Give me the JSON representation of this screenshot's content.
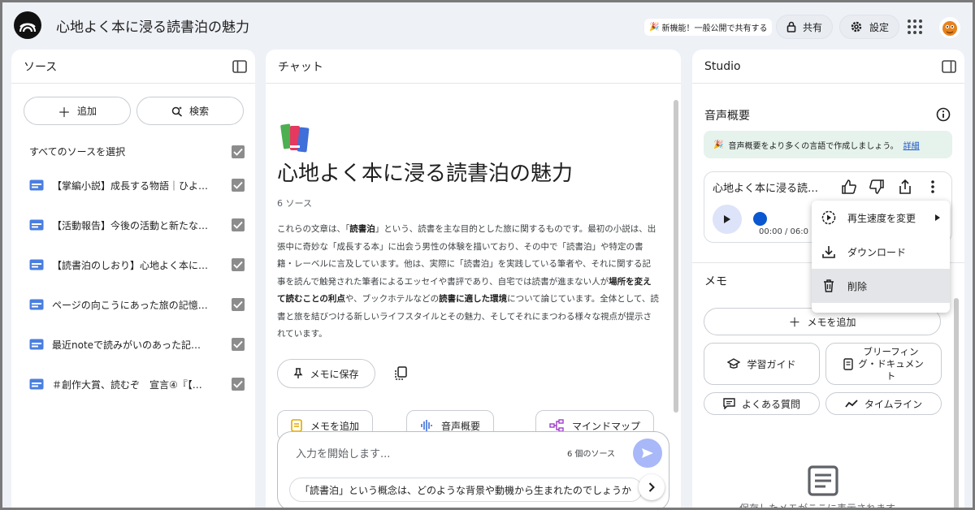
{
  "app": {
    "title": "心地よく本に浸る読書泊の魅力",
    "new_feature": "新機能！一般公開で共有する",
    "share": "共有",
    "settings": "設定"
  },
  "sources": {
    "heading": "ソース",
    "add": "追加",
    "search": "検索",
    "select_all": "すべてのソースを選択",
    "items": [
      {
        "label": "【掌編小説】成長する物語｜ひよ…"
      },
      {
        "label": "【活動報告】今後の活動と新たな…"
      },
      {
        "label": "【読書泊のしおり】心地よく本に…"
      },
      {
        "label": "ページの向こうにあった旅の記憶…"
      },
      {
        "label": "最近noteで読みがいのあった記事2…"
      },
      {
        "label": "＃創作大賞、読むぞ　宣言④『【読…"
      }
    ]
  },
  "chat": {
    "heading": "チャット",
    "notebook_title": "心地よく本に浸る読書泊の魅力",
    "source_count": "6 ソース",
    "summary": {
      "t1": "これらの文章は、「",
      "b1": "読書泊",
      "t2": "」という、読書を主な目的とした旅に関するものです。最初の小説は、出張中に奇妙な「成長する本」に出会う男性の体験を描いており、その中で「読書泊」や特定の書籍・レーベルに言及しています。他は、実際に「読書泊」を実践している筆者や、それに関する記事を読んで触発された筆者によるエッセイや書評であり、自宅では読書が進まない人が",
      "b2": "場所を変えて読むことの利点",
      "t3": "や、ブックホテルなどの",
      "b3": "読書に適した環境",
      "t4": "について論じています。全体として、読書と旅を結びつける新しいライフスタイルとその魅力、そしてそれにまつわる様々な視点が提示されています。"
    },
    "save_memo": "メモに保存",
    "chips": {
      "add_memo": "メモを追加",
      "audio": "音声概要",
      "mindmap": "マインドマップ"
    },
    "input_placeholder": "入力を開始します...",
    "input_sources": "6 個のソース",
    "suggestion": "「読書泊」という概念は、どのような背景や動機から生まれたのでしょうか"
  },
  "studio": {
    "heading": "Studio",
    "audio_overview": "音声概要",
    "banner_text": "音声概要をより多くの言語で作成しましょう。",
    "banner_link": "詳細",
    "audio_title": "心地よく本に浸る読…",
    "time": "00:00 / 06:0",
    "menu": {
      "speed": "再生速度を変更",
      "download": "ダウンロード",
      "delete": "削除"
    },
    "memo_heading": "メモ",
    "add_memo": "メモを追加",
    "study_guide": "学習ガイド",
    "briefing_l1": "ブリーフィン",
    "briefing_l2": "グ・ドキュメン",
    "briefing_l3": "ト",
    "faq": "よくある質問",
    "timeline": "タイムライン",
    "empty_text": "保存したメモがここに表示されます"
  },
  "colors": {
    "accent": "#0b57d0",
    "send": "#a8b8f8",
    "banner": "#e6f3ec",
    "bg": "#eef1f6"
  }
}
